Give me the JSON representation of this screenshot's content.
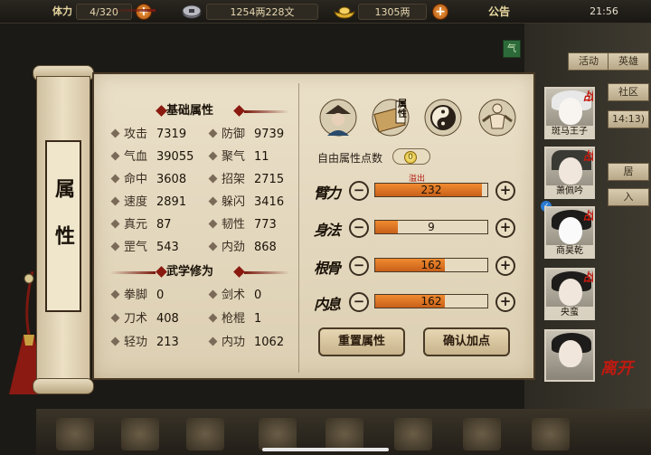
{
  "topbar": {
    "stamina_label": "体力",
    "stamina": "4/320",
    "copper": "1254两228文",
    "silver": "1305两",
    "notice": "公告",
    "clock": "21:56"
  },
  "background": {
    "qi_tag": "气",
    "right_tags": [
      "活动",
      "英雄",
      "社区",
      "14:13)",
      "居",
      "入"
    ]
  },
  "scroll": {
    "title": "属性"
  },
  "basic": {
    "header": "基础属性",
    "items": [
      {
        "name": "攻击",
        "value": "7319"
      },
      {
        "name": "防御",
        "value": "9739"
      },
      {
        "name": "气血",
        "value": "39055"
      },
      {
        "name": "聚气",
        "value": "11"
      },
      {
        "name": "命中",
        "value": "3608"
      },
      {
        "name": "招架",
        "value": "2715"
      },
      {
        "name": "速度",
        "value": "2891"
      },
      {
        "name": "躲闪",
        "value": "3416"
      },
      {
        "name": "真元",
        "value": "87"
      },
      {
        "name": "韧性",
        "value": "773"
      },
      {
        "name": "罡气",
        "value": "543"
      },
      {
        "name": "内劲",
        "value": "868"
      }
    ]
  },
  "martial": {
    "header": "武学修为",
    "items": [
      {
        "name": "拳脚",
        "value": "0"
      },
      {
        "name": "剑术",
        "value": "0"
      },
      {
        "name": "刀术",
        "value": "408"
      },
      {
        "name": "枪棍",
        "value": "1"
      },
      {
        "name": "轻功",
        "value": "213"
      },
      {
        "name": "内功",
        "value": "1062"
      }
    ]
  },
  "points": {
    "free_label": "自由属性点数",
    "free_value": "0",
    "overflow_label": "溢出",
    "rows": [
      {
        "label": "臂力",
        "value": "232",
        "fill": 0.95
      },
      {
        "label": "身法",
        "value": "9",
        "fill": 0.2
      },
      {
        "label": "根骨",
        "value": "162",
        "fill": 0.62
      },
      {
        "label": "内息",
        "value": "162",
        "fill": 0.62
      }
    ],
    "reset_label": "重置属性",
    "confirm_label": "确认加点"
  },
  "tabs": [
    {
      "icon": "hero-icon"
    },
    {
      "icon": "attribute-book-icon",
      "label": "属性"
    },
    {
      "icon": "taiji-icon"
    },
    {
      "icon": "meridian-icon"
    }
  ],
  "party": [
    {
      "name": "斑马王子",
      "badge": "战"
    },
    {
      "name": "萧佩吟",
      "badge": "战"
    },
    {
      "name": "商昊乾",
      "badge": "战"
    },
    {
      "name": "央蛮",
      "badge": "战"
    },
    {
      "name": "",
      "badge": ""
    }
  ],
  "leave_label": "离开",
  "colors": {
    "accent": "#c01a10",
    "bar_fill": "#e87a28",
    "parchment": "#e6dac0"
  }
}
